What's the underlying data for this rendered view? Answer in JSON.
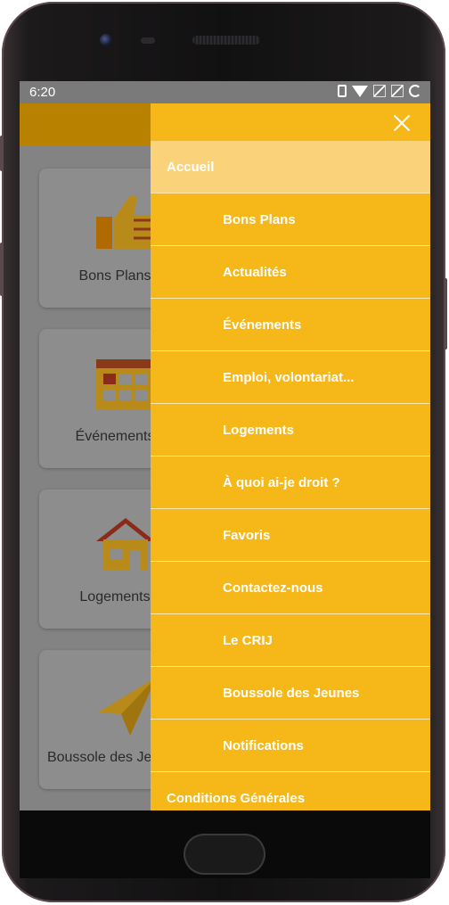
{
  "status": {
    "time": "6:20"
  },
  "cards": [
    {
      "label": "Bons Plans",
      "icon": "thumbs-up-icon"
    },
    {
      "label": "Événements",
      "icon": "calendar-icon"
    },
    {
      "label": "Logements",
      "icon": "house-icon"
    },
    {
      "label": "Boussole des Jeunes",
      "icon": "paper-plane-icon"
    }
  ],
  "drawer": {
    "items": [
      {
        "label": "Accueil"
      },
      {
        "label": "Bons Plans"
      },
      {
        "label": "Actualités"
      },
      {
        "label": "Événements"
      },
      {
        "label": "Emploi, volontariat..."
      },
      {
        "label": "Logements"
      },
      {
        "label": "À quoi ai-je droit ?"
      },
      {
        "label": "Favoris"
      },
      {
        "label": "Contactez-nous"
      },
      {
        "label": "Le CRIJ"
      },
      {
        "label": "Boussole des Jeunes"
      },
      {
        "label": "Notifications"
      },
      {
        "label": "Conditions Générales"
      }
    ]
  },
  "colors": {
    "accent": "#f6b719",
    "active_item": "#f9d27a",
    "appbar": "#b88200"
  }
}
